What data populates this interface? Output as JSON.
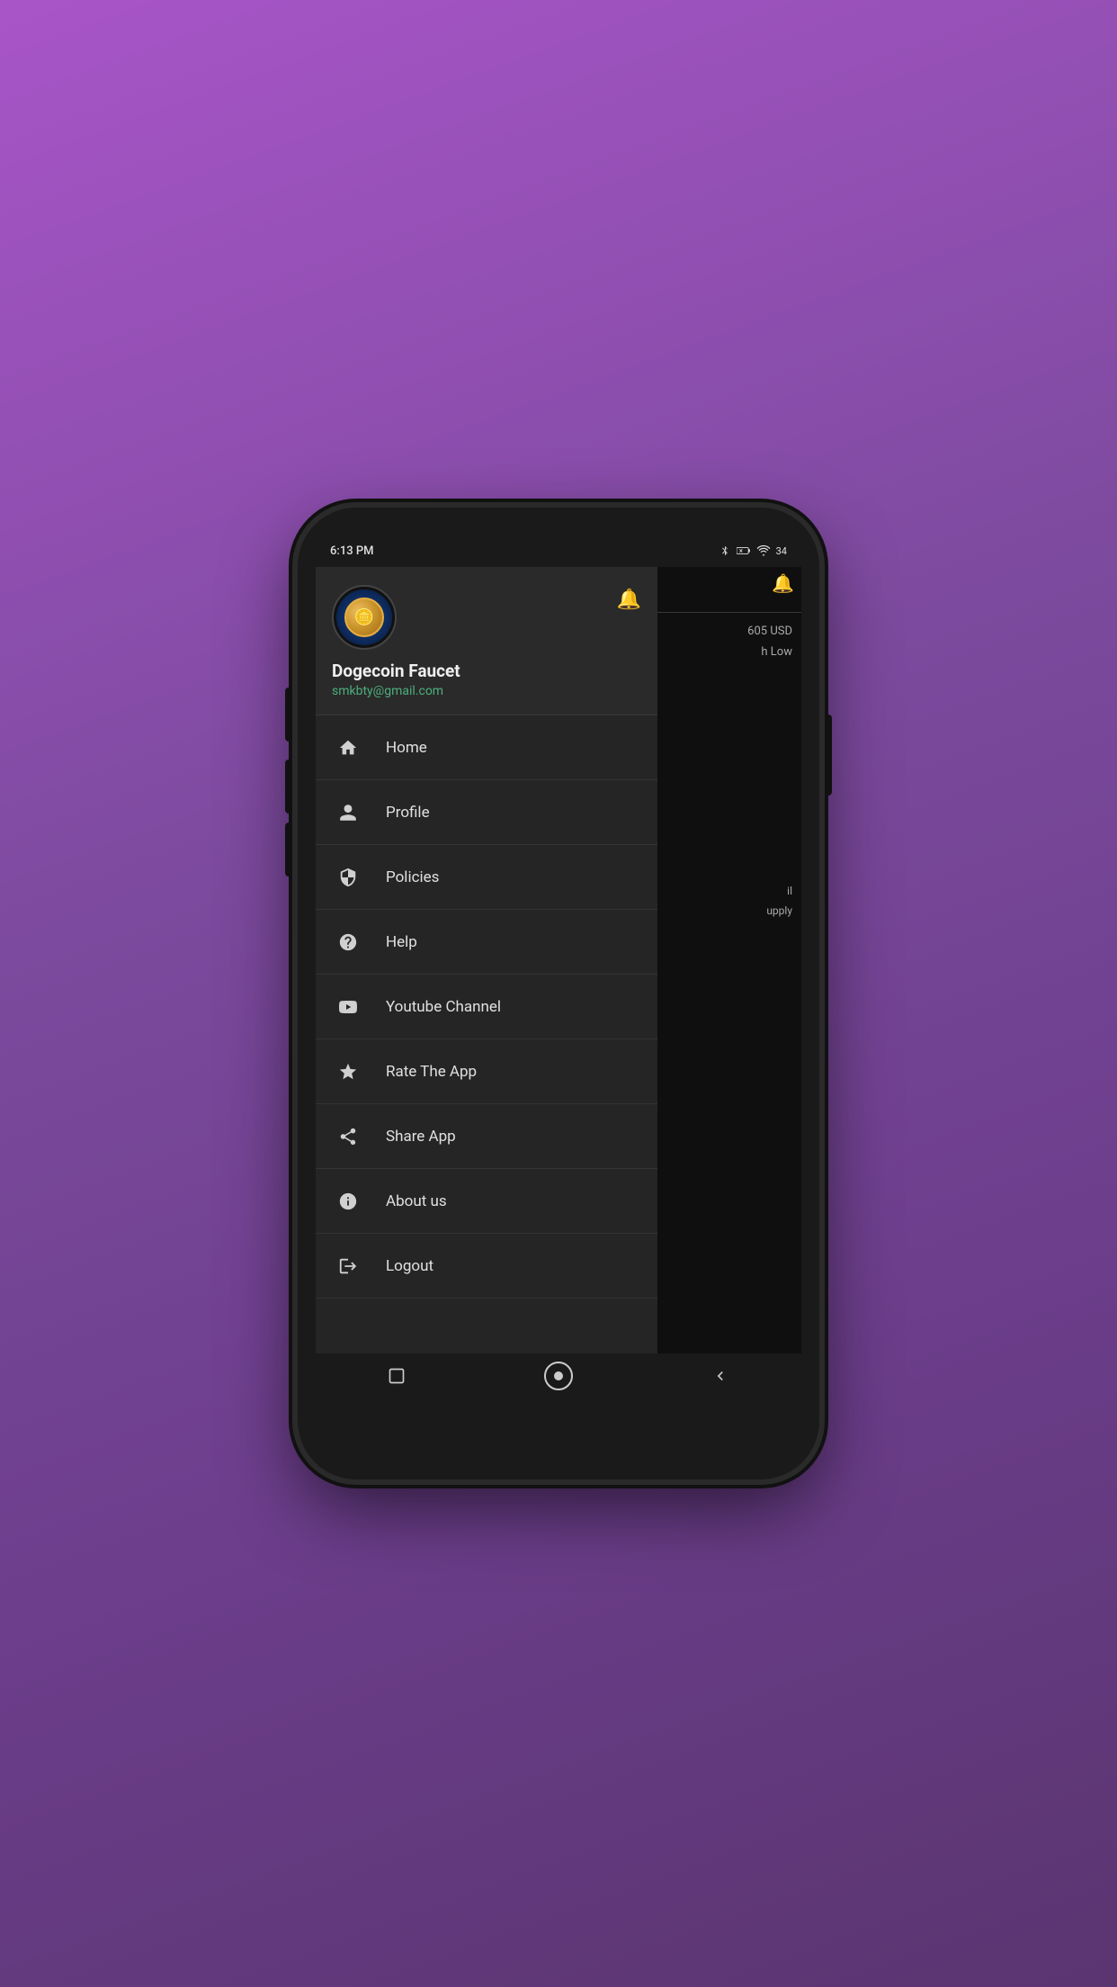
{
  "statusBar": {
    "time": "6:13 PM",
    "icons": [
      "bluetooth",
      "battery-x",
      "wifi",
      "battery-34"
    ]
  },
  "drawer": {
    "appName": "Dogecoin Faucet",
    "email": "smkbty@gmail.com",
    "balanceText1": "605 USD",
    "balanceText2": "h Low",
    "bgText2Line1": "il",
    "bgText2Line2": "upply"
  },
  "menuItems": [
    {
      "id": "home",
      "label": "Home",
      "icon": "home"
    },
    {
      "id": "profile",
      "label": "Profile",
      "icon": "person"
    },
    {
      "id": "policies",
      "label": "Policies",
      "icon": "shield"
    },
    {
      "id": "help",
      "label": "Help",
      "icon": "question"
    },
    {
      "id": "youtube",
      "label": "Youtube Channel",
      "icon": "youtube"
    },
    {
      "id": "rate",
      "label": "Rate The App",
      "icon": "star"
    },
    {
      "id": "share",
      "label": "Share App",
      "icon": "share"
    },
    {
      "id": "about",
      "label": "About us",
      "icon": "info"
    },
    {
      "id": "logout",
      "label": "Logout",
      "icon": "logout"
    }
  ],
  "navBar": {
    "squareLabel": "■",
    "circleLabel": "⬤",
    "backLabel": "◀"
  }
}
